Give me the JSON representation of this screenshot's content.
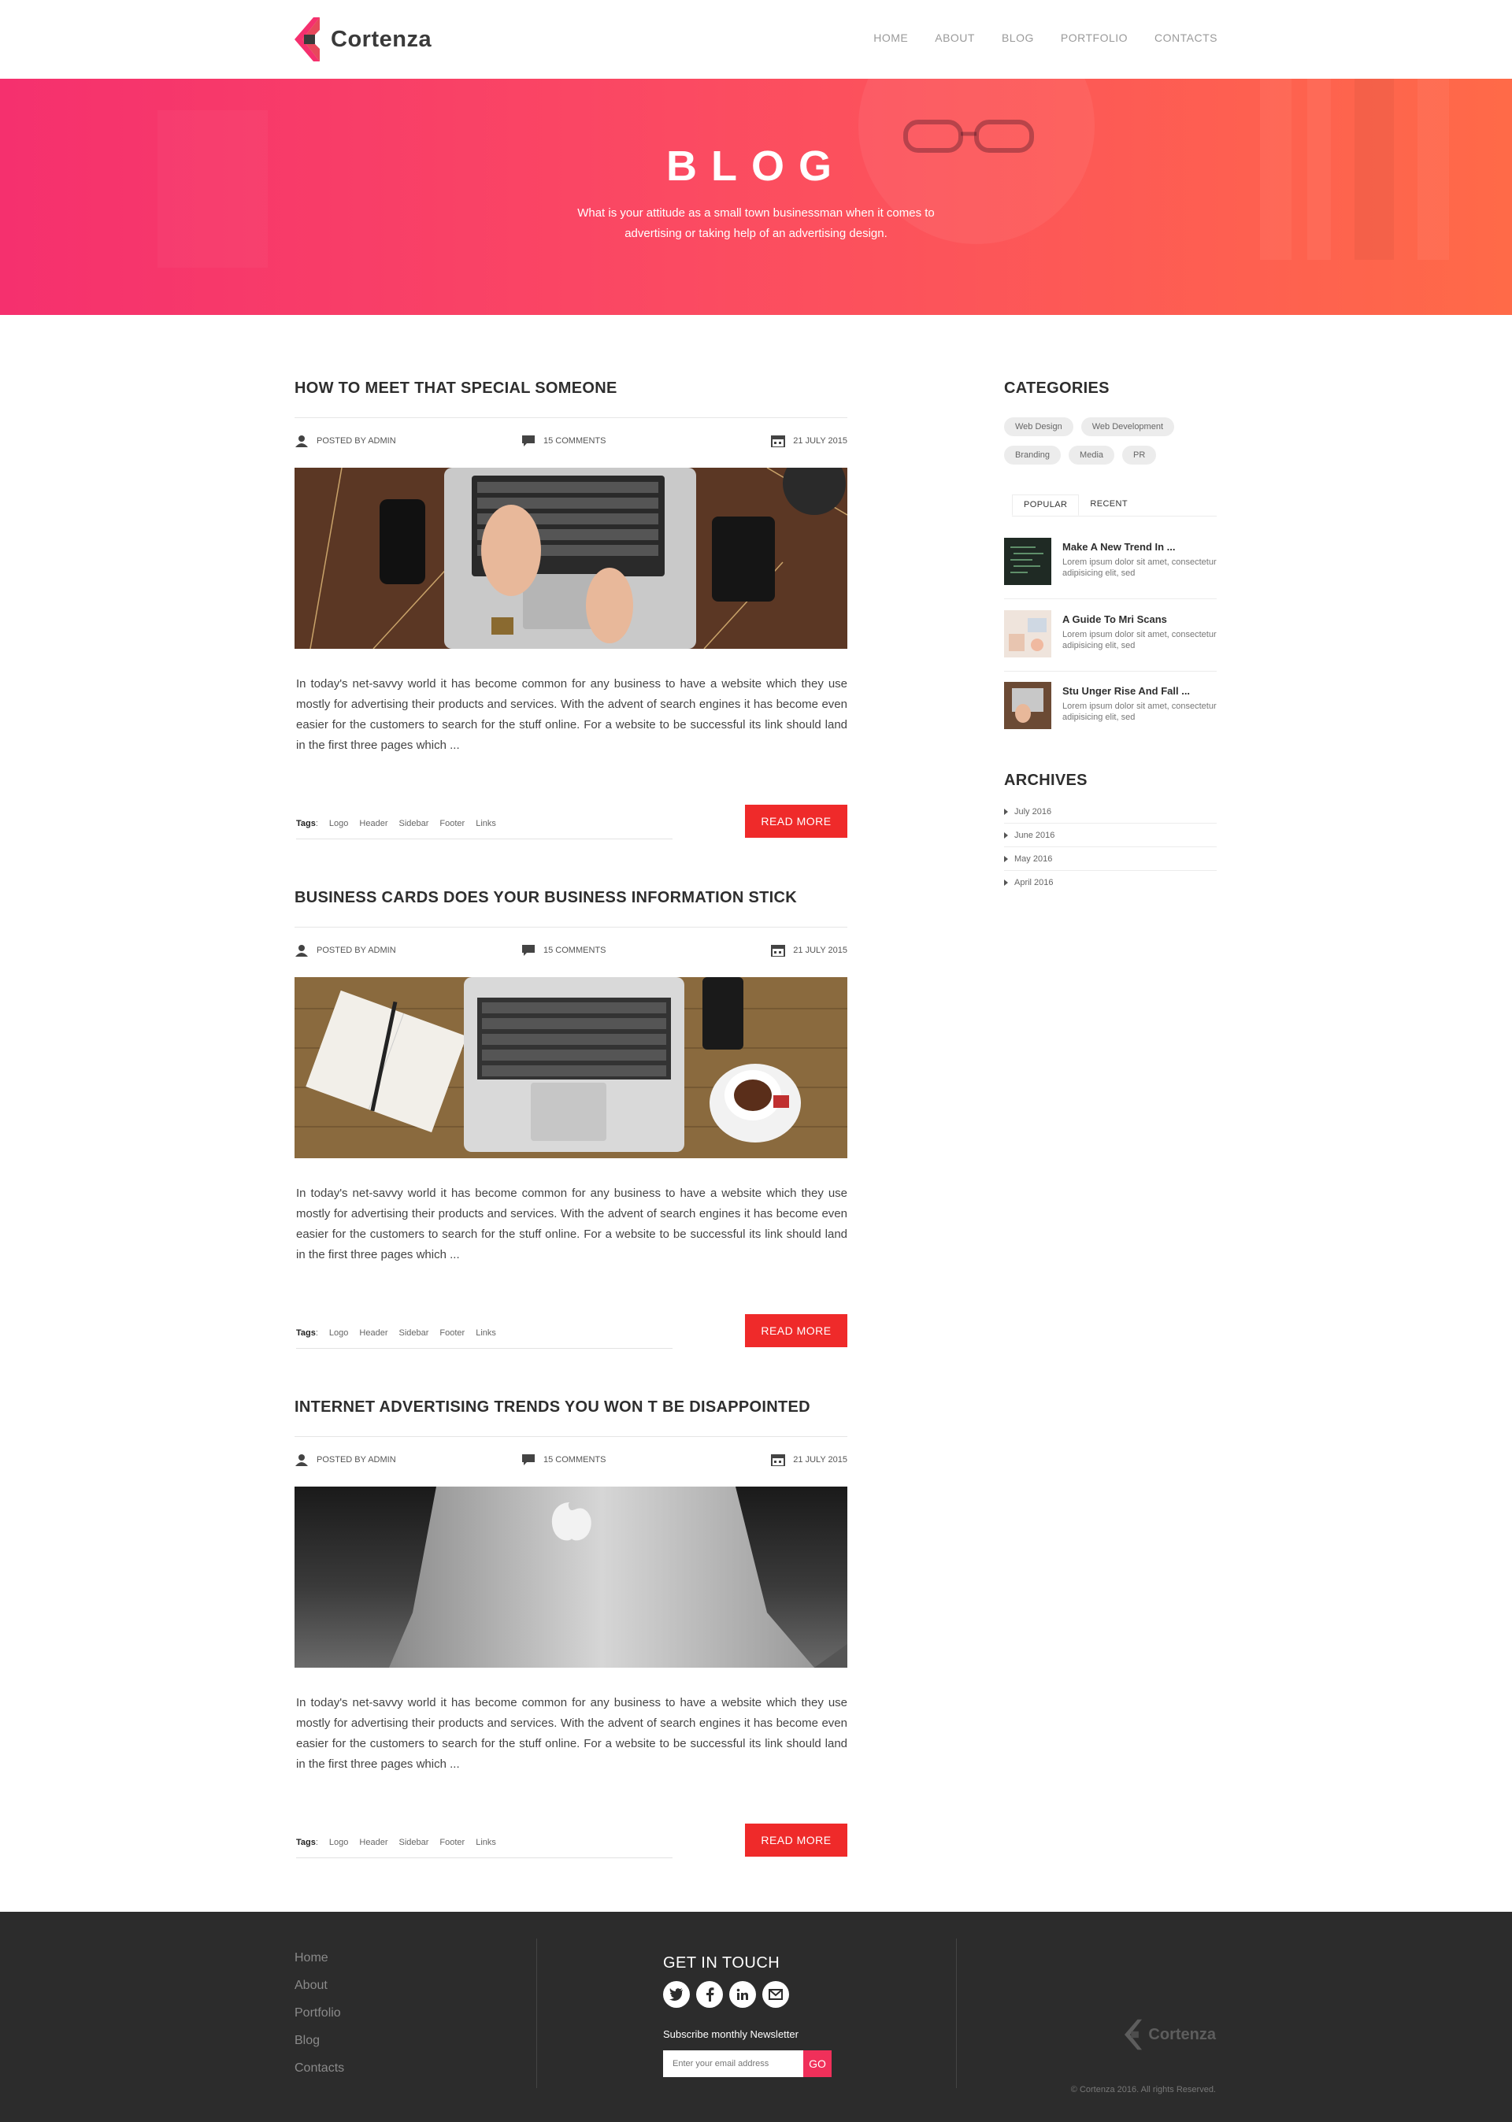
{
  "brand": {
    "name": "Cortenza",
    "accent": "#f5306e",
    "button": "#ef2a2a"
  },
  "nav": {
    "items": [
      "HOME",
      "ABOUT",
      "BLOG",
      "PORTFOLIO",
      "CONTACTS"
    ]
  },
  "hero": {
    "title": "BLOG",
    "subtitle": "What is your attitude as a small town businessman when it comes to advertising or taking help of an advertising design."
  },
  "posts": [
    {
      "title": "HOW TO MEET THAT SPECIAL SOMEONE",
      "author": "POSTED BY ADMIN",
      "comments": "15 COMMENTS",
      "date": "21 JULY 2015",
      "image": "laptop-typing-desk",
      "body": "In today's net-savvy world it has become common for any business to have a website which they use mostly for advertising their products and services. With the advent of search engines it has become even easier for the customers to search for the stuff online. For a website to be successful its link should land in the first three pages which ...",
      "tags_label": "Tags",
      "tags": [
        "Logo",
        "Header",
        "Sidebar",
        "Footer",
        "Links"
      ],
      "read_more": "READ MORE"
    },
    {
      "title": "BUSINESS CARDS DOES YOUR BUSINESS INFORMATION STICK",
      "author": "POSTED BY ADMIN",
      "comments": "15 COMMENTS",
      "date": "21 JULY 2015",
      "image": "laptop-notebook-coffee",
      "body": "In today's net-savvy world it has become common for any business to have a website which they use mostly for advertising their products and services. With the advent of search engines it has become even easier for the customers to search for the stuff online. For a website to be successful its link should land in the first three pages which ...",
      "tags_label": "Tags",
      "tags": [
        "Logo",
        "Header",
        "Sidebar",
        "Footer",
        "Links"
      ],
      "read_more": "READ MORE"
    },
    {
      "title": "INTERNET ADVERTISING TRENDS YOU WON T BE DISAPPOINTED",
      "author": "POSTED BY ADMIN",
      "comments": "15 COMMENTS",
      "date": "21 JULY 2015",
      "image": "macbook-dark",
      "body": "In today's net-savvy world it has become common for any business to have a website which they use mostly for advertising their products and services. With the advent of search engines it has become even easier for the customers to search for the stuff online. For a website to be successful its link should land in the first three pages which ...",
      "tags_label": "Tags",
      "tags": [
        "Logo",
        "Header",
        "Sidebar",
        "Footer",
        "Links"
      ],
      "read_more": "READ MORE"
    }
  ],
  "sidebar": {
    "categories_title": "CATEGORIES",
    "categories": [
      "Web Design",
      "Web Development",
      "Branding",
      "Media",
      "PR"
    ],
    "tabs": [
      "POPULAR",
      "RECENT"
    ],
    "popular": [
      {
        "title": "Make A New Trend In ...",
        "text": "Lorem ipsum dolor sit amet, consectetur adipisicing elit, sed"
      },
      {
        "title": "A Guide To Mri Scans",
        "text": "Lorem ipsum dolor sit amet, consectetur adipisicing elit, sed"
      },
      {
        "title": "Stu Unger Rise And Fall ...",
        "text": "Lorem ipsum dolor sit amet, consectetur adipisicing elit, sed"
      }
    ],
    "archives_title": "ARCHIVES",
    "archives": [
      "July 2016",
      "June 2016",
      "May 2016",
      "April 2016"
    ]
  },
  "footer": {
    "links": [
      "Home",
      "About",
      "Portfolio",
      "Blog",
      "Contacts"
    ],
    "touch_title": "GET IN TOUCH",
    "socials": [
      "twitter-icon",
      "facebook-icon",
      "linkedin-icon",
      "mail-icon"
    ],
    "subscribe_label": "Subscribe monthly Newsletter",
    "email_placeholder": "Enter your email address",
    "go_label": "GO",
    "logo_text": "Cortenza",
    "copyright": "© Cortenza 2016. All rights Reserved."
  }
}
